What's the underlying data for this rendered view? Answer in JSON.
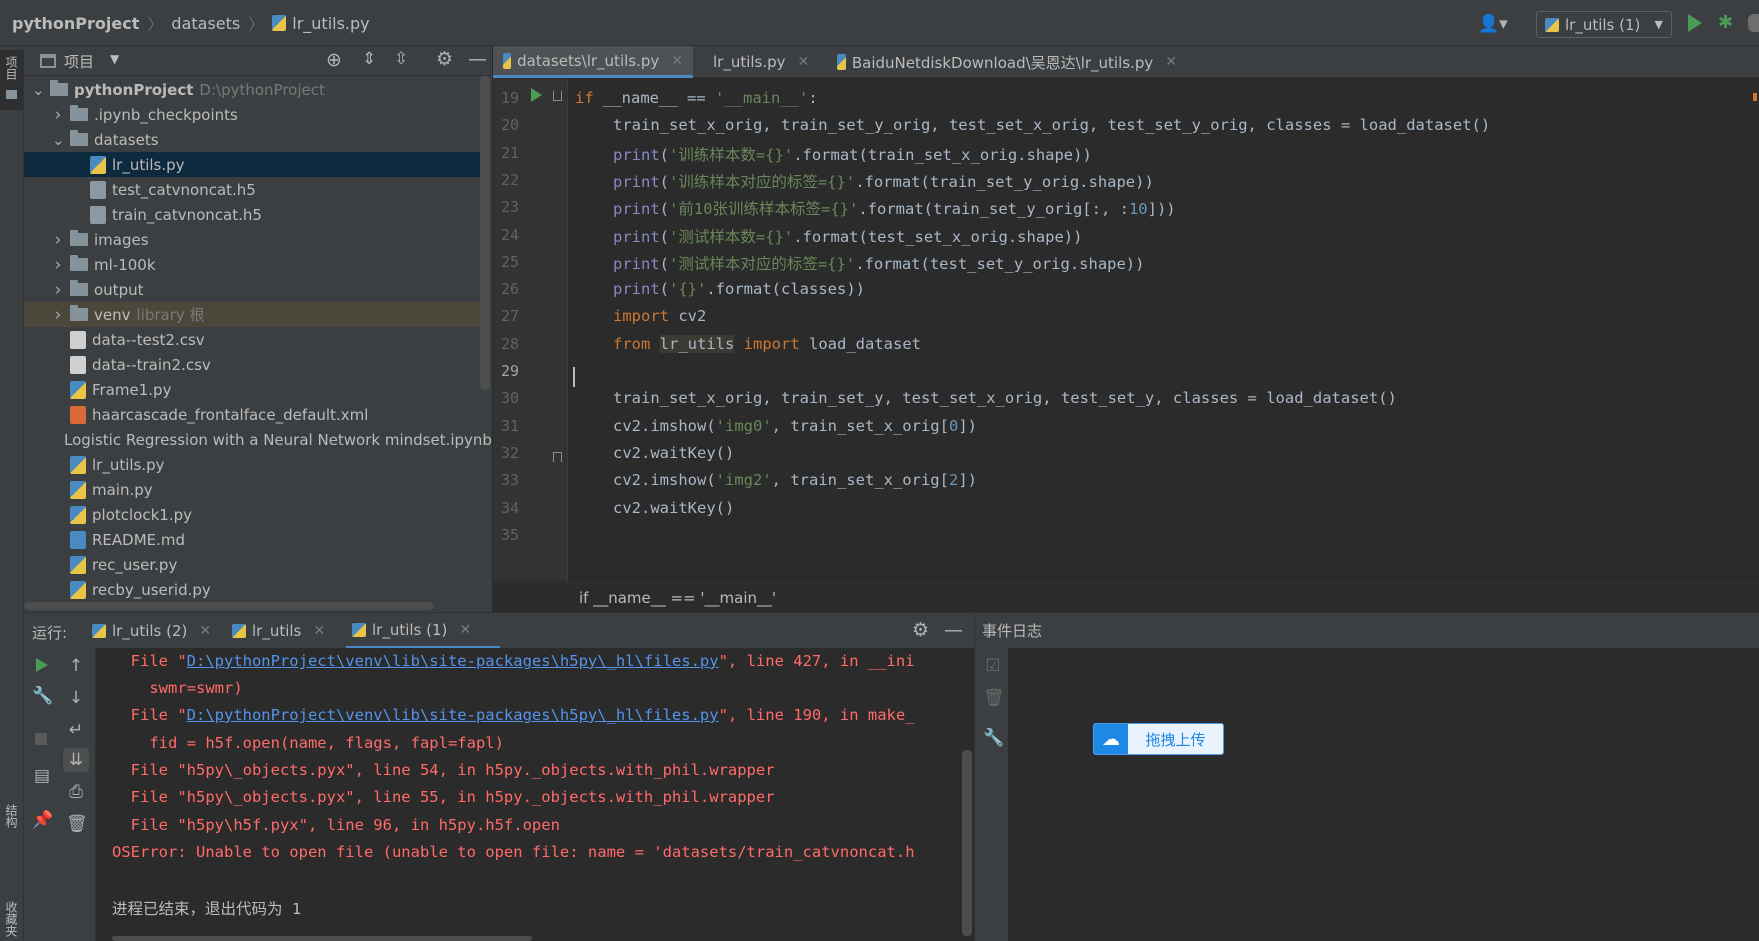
{
  "navbar": {
    "crumbs": [
      "pythonProject",
      "datasets",
      "lr_utils.py"
    ],
    "run_config": "lr_utils (1)",
    "user_icon": "user-icon",
    "run_icon": "play-icon",
    "debug_icon": "bug-icon"
  },
  "left_stripe": {
    "project_label": "项目",
    "structure_label": "结构",
    "favorites_label": "收藏夹"
  },
  "project_panel": {
    "title": "项目",
    "tree": [
      {
        "name": "pythonProject",
        "path": "D:\\pythonProject",
        "kind": "folder",
        "expanded": true
      },
      {
        "name": ".ipynb_checkpoints",
        "kind": "folder",
        "expanded": false
      },
      {
        "name": "datasets",
        "kind": "folder",
        "expanded": true
      },
      {
        "name": "lr_utils.py",
        "kind": "py",
        "selected": true
      },
      {
        "name": "test_catvnoncat.h5",
        "kind": "h5"
      },
      {
        "name": "train_catvnoncat.h5",
        "kind": "h5"
      },
      {
        "name": "images",
        "kind": "folder",
        "expanded": false
      },
      {
        "name": "ml-100k",
        "kind": "folder",
        "expanded": false
      },
      {
        "name": "output",
        "kind": "folder",
        "expanded": false
      },
      {
        "name": "venv",
        "extra": "library 根",
        "kind": "folder",
        "expanded": false
      },
      {
        "name": "data--test2.csv",
        "kind": "csv"
      },
      {
        "name": "data--train2.csv",
        "kind": "csv"
      },
      {
        "name": "Frame1.py",
        "kind": "py"
      },
      {
        "name": "haarcascade_frontalface_default.xml",
        "kind": "xml"
      },
      {
        "name": "Logistic Regression with a Neural Network mindset.ipynb",
        "kind": "nb"
      },
      {
        "name": "lr_utils.py",
        "kind": "py"
      },
      {
        "name": "main.py",
        "kind": "py"
      },
      {
        "name": "plotclock1.py",
        "kind": "py"
      },
      {
        "name": "README.md",
        "kind": "md"
      },
      {
        "name": "rec_user.py",
        "kind": "py"
      },
      {
        "name": "recby_userid.py",
        "kind": "py"
      }
    ]
  },
  "editor": {
    "tabs": [
      {
        "label": "datasets\\lr_utils.py",
        "active": true
      },
      {
        "label": "lr_utils.py",
        "active": false
      },
      {
        "label": "BaiduNetdiskDownload\\吴恩达\\lr_utils.py",
        "active": false
      }
    ],
    "line_numbers": [
      "19",
      "20",
      "21",
      "22",
      "23",
      "24",
      "25",
      "26",
      "27",
      "28",
      "29",
      "30",
      "31",
      "32",
      "33",
      "34",
      "35"
    ],
    "code": {
      "l19_kw": "if",
      "l19_a": " __name__ == ",
      "l19_s": "'__main__'",
      "l19_b": ":",
      "l20": "train_set_x_orig, train_set_y_orig, test_set_x_orig, test_set_y_orig, classes = load_dataset()",
      "l21_s": "'训练样本数={}'",
      "l21_b": ".format(train_set_x_orig.shape))",
      "l22_s": "'训练样本对应的标签={}'",
      "l22_b": ".format(train_set_y_orig.shape))",
      "l23_s": "'前10张训练样本标签={}'",
      "l23_b": ".format(train_set_y_orig[:, :",
      "l23_n": "10",
      "l23_c": "]))",
      "l24_s": "'测试样本数={}'",
      "l24_b": ".format(test_set_x_orig.shape))",
      "l25_s": "'测试样本对应的标签={}'",
      "l25_b": ".format(test_set_y_orig.shape))",
      "l26_s": "'{}'",
      "l26_b": ".format(classes))",
      "print": "print",
      "paren": "(",
      "l27_kw": "import",
      "l27_a": " cv2",
      "l28_kw1": "from",
      "l28_mod": "lr_utils",
      "l28_kw2": "import",
      "l28_a": " load_dataset",
      "l30": "train_set_x_orig, train_set_y, test_set_x_orig, test_set_y, classes = load_dataset()",
      "l31_a": "cv2.imshow(",
      "l31_s": "'img0'",
      "l31_b": ", train_set_x_orig[",
      "l31_n": "0",
      "l31_c": "])",
      "l32": "cv2.waitKey()",
      "l33_a": "cv2.imshow(",
      "l33_s": "'img2'",
      "l33_b": ", train_set_x_orig[",
      "l33_n": "2",
      "l33_c": "])",
      "l34": "cv2.waitKey()"
    },
    "breadcrumb": "if __name__ == '__main__'"
  },
  "run_panel": {
    "label": "运行:",
    "tabs": [
      {
        "label": "lr_utils (2)",
        "active": false
      },
      {
        "label": "lr_utils",
        "active": false
      },
      {
        "label": "lr_utils (1)",
        "active": true
      }
    ],
    "console": {
      "l1_a": "  File \"",
      "l1_link": "D:\\pythonProject\\venv\\lib\\site-packages\\h5py\\_hl\\files.py",
      "l1_b": "\", line 427, in __ini",
      "l2": "    swmr=swmr)",
      "l3_a": "  File \"",
      "l3_link": "D:\\pythonProject\\venv\\lib\\site-packages\\h5py\\_hl\\files.py",
      "l3_b": "\", line 190, in make_",
      "l4": "    fid = h5f.open(name, flags, fapl=fapl)",
      "l5": "  File \"h5py\\_objects.pyx\", line 54, in h5py._objects.with_phil.wrapper",
      "l6": "  File \"h5py\\_objects.pyx\", line 55, in h5py._objects.with_phil.wrapper",
      "l7": "  File \"h5py\\h5f.pyx\", line 96, in h5py.h5f.open",
      "l8": "OSError: Unable to open file (unable to open file: name = 'datasets/train_catvnoncat.h",
      "l9": "进程已结束，退出代码为 1"
    }
  },
  "event_log": {
    "title": "事件日志",
    "upload_label": "拖拽上传"
  },
  "colors": {
    "accent": "#4a88c7",
    "error_text": "#ff6b68",
    "link": "#5394ec",
    "run_green": "#499c54"
  }
}
